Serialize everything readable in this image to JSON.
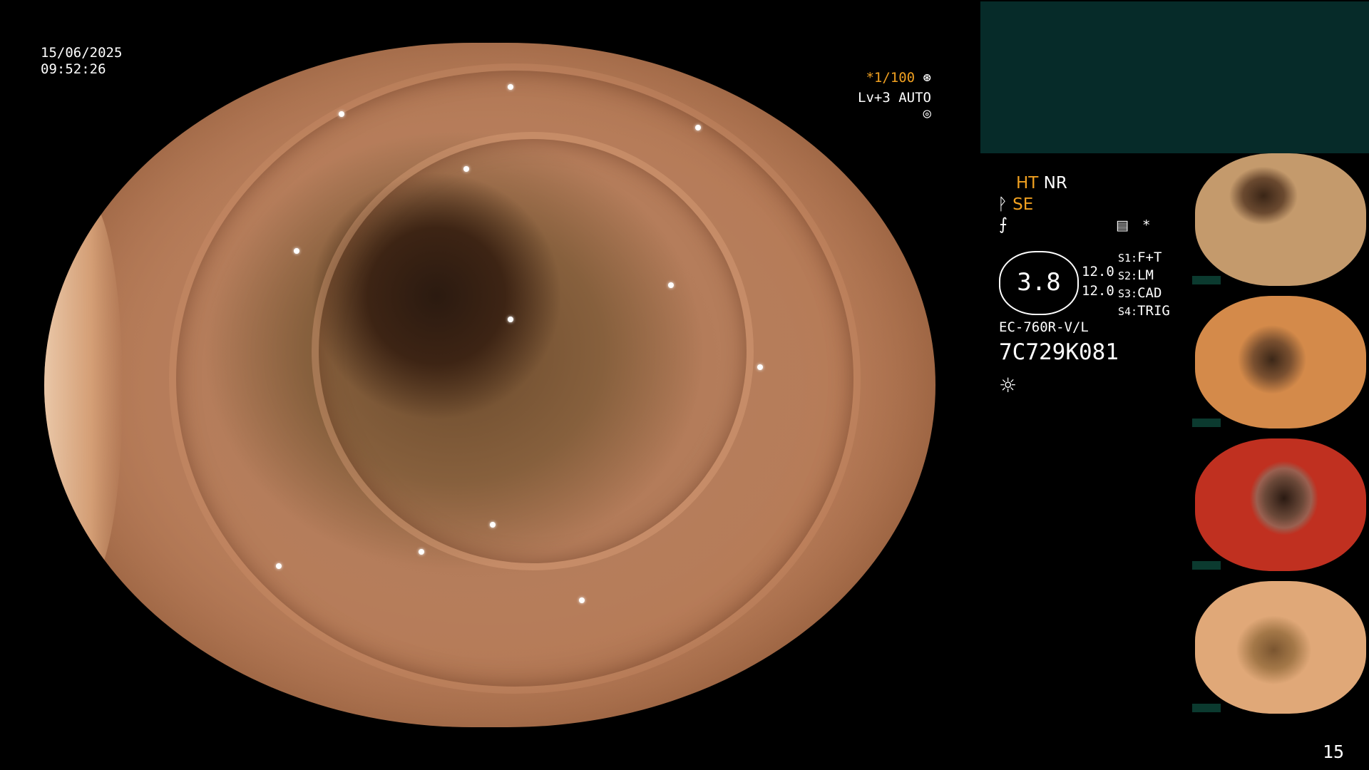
{
  "overlay": {
    "date": "15/06/2025",
    "time": "09:52:26",
    "zoom": "*1/100",
    "level": "Lv+3 AUTO"
  },
  "settings": {
    "ht": "HT",
    "nr": "NR",
    "se": "SE",
    "gauge_value": "3.8",
    "val_1": "12.0",
    "val_2": "12.0",
    "s1_label": "S1:",
    "s1_value": "F+T",
    "s2_label": "S2:",
    "s2_value": "LM",
    "s3_label": "S3:",
    "s3_value": "CAD",
    "s4_label": "S4:",
    "s4_value": "TRIG",
    "asterisk": "*",
    "scope_model": "EC-760R-V/L",
    "serial": "7C729K081"
  },
  "thumbnail_label": "7C729K081",
  "page_number": "15",
  "colors": {
    "accent_orange": "#f0a020",
    "panel_teal": "#062b29"
  },
  "icons": [
    "aperture-icon",
    "settings-circle-icon",
    "scope-icon",
    "stroke-icon",
    "memory-icon",
    "light-icon"
  ]
}
